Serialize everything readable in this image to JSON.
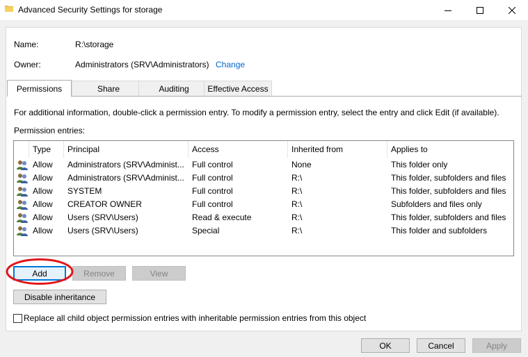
{
  "window": {
    "title": "Advanced Security Settings for storage",
    "minimize_icon": "minimize-icon",
    "maximize_icon": "maximize-icon",
    "close_icon": "close-icon"
  },
  "info": {
    "name_label": "Name:",
    "name_value": "R:\\storage",
    "owner_label": "Owner:",
    "owner_value": "Administrators (SRV\\Administrators)",
    "change_link": "Change"
  },
  "tabs": [
    {
      "label": "Permissions",
      "active": true
    },
    {
      "label": "Share",
      "active": false
    },
    {
      "label": "Auditing",
      "active": false
    },
    {
      "label": "Effective Access",
      "active": false
    }
  ],
  "permissions": {
    "description": "For additional information, double-click a permission entry. To modify a permission entry, select the entry and click Edit (if available).",
    "entries_label": "Permission entries:",
    "columns": [
      "Type",
      "Principal",
      "Access",
      "Inherited from",
      "Applies to"
    ],
    "rows": [
      {
        "type": "Allow",
        "principal": "Administrators (SRV\\Administ...",
        "access": "Full control",
        "inherited": "None",
        "applies": "This folder only"
      },
      {
        "type": "Allow",
        "principal": "Administrators (SRV\\Administ...",
        "access": "Full control",
        "inherited": "R:\\",
        "applies": "This folder, subfolders and files"
      },
      {
        "type": "Allow",
        "principal": "SYSTEM",
        "access": "Full control",
        "inherited": "R:\\",
        "applies": "This folder, subfolders and files"
      },
      {
        "type": "Allow",
        "principal": "CREATOR OWNER",
        "access": "Full control",
        "inherited": "R:\\",
        "applies": "Subfolders and files only"
      },
      {
        "type": "Allow",
        "principal": "Users (SRV\\Users)",
        "access": "Read & execute",
        "inherited": "R:\\",
        "applies": "This folder, subfolders and files"
      },
      {
        "type": "Allow",
        "principal": "Users (SRV\\Users)",
        "access": "Special",
        "inherited": "R:\\",
        "applies": "This folder and subfolders"
      }
    ]
  },
  "buttons": {
    "add": "Add",
    "remove": "Remove",
    "view": "View",
    "disable_inheritance": "Disable inheritance",
    "ok": "OK",
    "cancel": "Cancel",
    "apply": "Apply"
  },
  "replace_checkbox": {
    "label": "Replace all child object permission entries with inheritable permission entries from this object",
    "checked": false
  },
  "colors": {
    "link": "#0066cc",
    "annotation_circle": "#e0161b"
  }
}
